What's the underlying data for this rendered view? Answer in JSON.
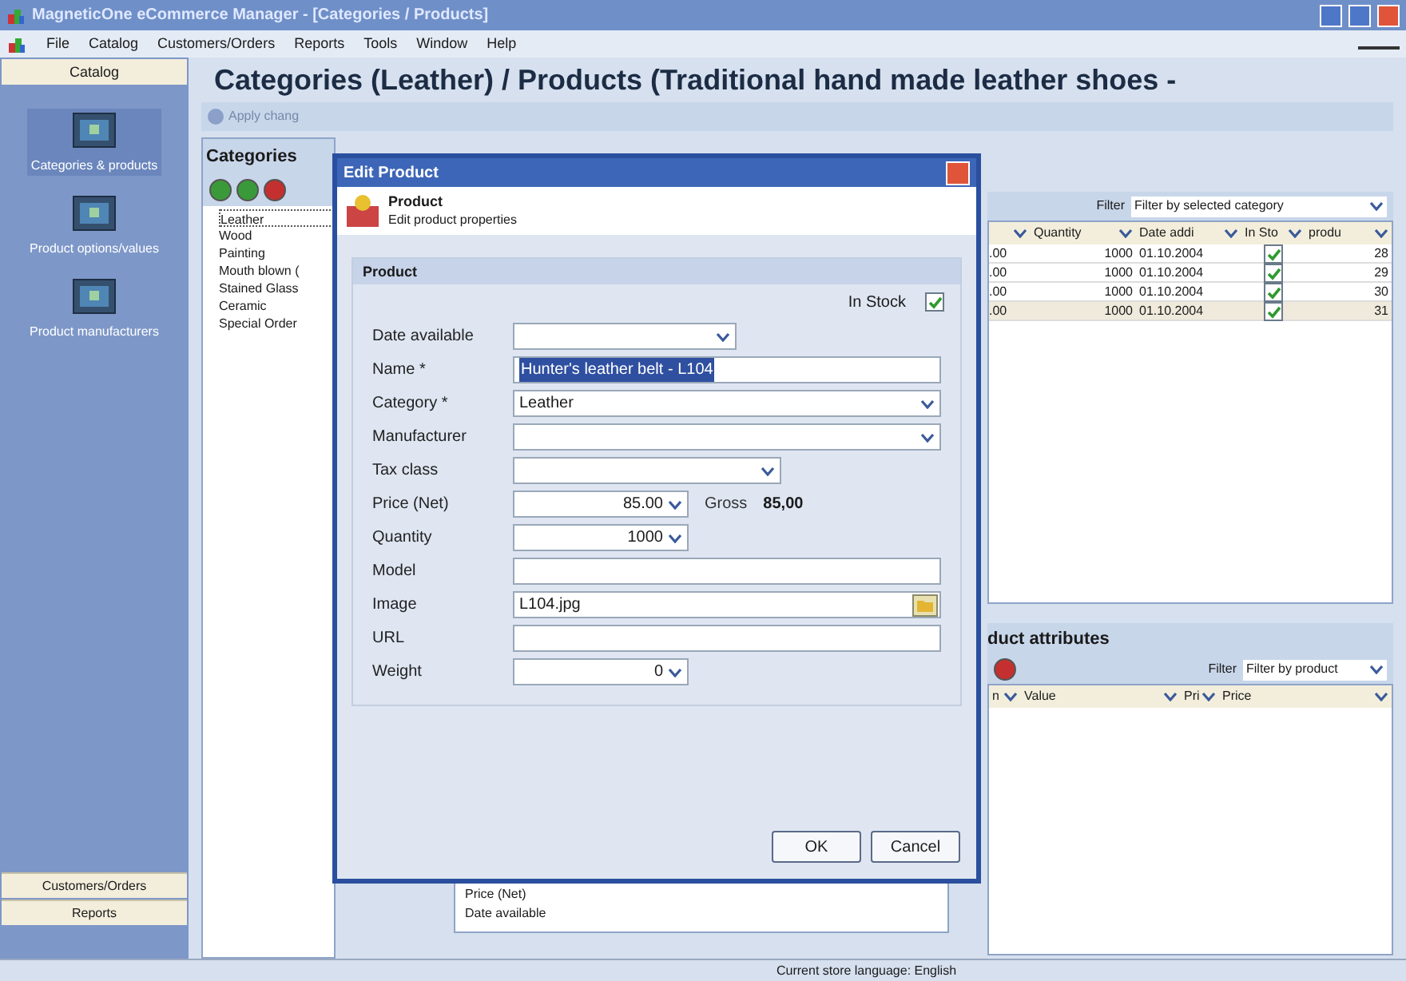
{
  "window": {
    "title": "MagneticOne eCommerce Manager - [Categories / Products]"
  },
  "menu": [
    "File",
    "Catalog",
    "Customers/Orders",
    "Reports",
    "Tools",
    "Window",
    "Help"
  ],
  "sidebar": {
    "header": "Catalog",
    "items": [
      {
        "label": "Categories & products",
        "selected": true
      },
      {
        "label": "Product options/values",
        "selected": false
      },
      {
        "label": "Product manufacturers",
        "selected": false
      }
    ],
    "bottom": [
      "Customers/Orders",
      "Reports"
    ]
  },
  "page_title": "Categories (Leather) / Products (Traditional hand made leather shoes -",
  "toolbar": {
    "apply": "Apply chang"
  },
  "categories": {
    "title": "Categories",
    "items": [
      {
        "label": "Leather",
        "selected": true
      },
      {
        "label": "Wood",
        "selected": false
      },
      {
        "label": "Painting",
        "selected": false
      },
      {
        "label": "Mouth blown (",
        "selected": false
      },
      {
        "label": "Stained Glass",
        "selected": false
      },
      {
        "label": "Ceramic",
        "selected": false
      },
      {
        "label": "Special Order",
        "selected": false
      }
    ]
  },
  "properties": [
    "Price (Net)",
    "Date available"
  ],
  "products": {
    "filter_label": "Filter",
    "filter_value": "Filter by selected category",
    "columns": [
      "Quantity",
      "Date addi",
      "In Sto",
      "produ"
    ],
    "rows": [
      {
        "column_1": ".00",
        "quantity": "1000",
        "date": "01.10.2004",
        "in_stock": true,
        "product": "28"
      },
      {
        "column_1": ".00",
        "quantity": "1000",
        "date": "01.10.2004",
        "in_stock": true,
        "product": "29"
      },
      {
        "column_1": ".00",
        "quantity": "1000",
        "date": "01.10.2004",
        "in_stock": true,
        "product": "30"
      },
      {
        "column_1": ".00",
        "quantity": "1000",
        "date": "01.10.2004",
        "in_stock": true,
        "product": "31"
      }
    ]
  },
  "attributes": {
    "title": "duct attributes",
    "filter_label": "Filter",
    "filter_value": "Filter by product",
    "columns": [
      "n",
      "Value",
      "Pri",
      "Price"
    ]
  },
  "status_bar": "Current store language: English",
  "dialog": {
    "title": "Edit Product",
    "heading": "Product",
    "subheading": "Edit product properties",
    "group": "Product",
    "in_stock_label": "In Stock",
    "in_stock": true,
    "fields": [
      {
        "kind": "date",
        "label": "Date available"
      },
      {
        "kind": "text",
        "label": "Name *",
        "value": "Hunter's leather belt - L104",
        "selected": true
      },
      {
        "kind": "combo",
        "label": "Category *",
        "value": "Leather"
      },
      {
        "kind": "combo",
        "label": "Manufacturer"
      },
      {
        "kind": "short-combo",
        "label": "Tax class"
      },
      {
        "kind": "spin",
        "label": "Price (Net)",
        "value": "85.00",
        "extra_label": "Gross",
        "extra_value": "85,00"
      },
      {
        "kind": "spin",
        "label": "Quantity",
        "value": "1000"
      },
      {
        "kind": "text",
        "label": "Model"
      },
      {
        "kind": "file",
        "label": "Image",
        "value": "L104.jpg"
      },
      {
        "kind": "text",
        "label": "URL"
      },
      {
        "kind": "spin",
        "label": "Weight",
        "value": "0"
      }
    ],
    "buttons": [
      "OK",
      "Cancel"
    ]
  }
}
